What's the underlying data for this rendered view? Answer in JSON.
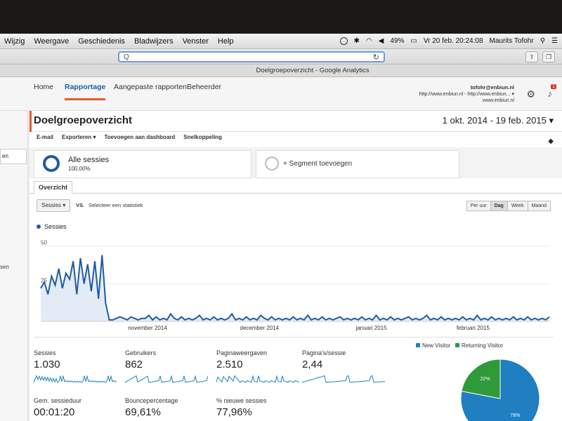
{
  "menubar": {
    "items": [
      "Wijzig",
      "Weergave",
      "Geschiedenis",
      "Bladwijzers",
      "Venster",
      "Help"
    ],
    "battery": "49%",
    "datetime": "Vr 20 feb.  20:24:08",
    "user": "Maurits Tofohr"
  },
  "browser": {
    "url_placeholder": "Q",
    "tab_title": "Doelgroepoverzicht - Google Analytics"
  },
  "ga_nav": {
    "items": [
      "Home",
      "Rapportage",
      "Aangepaste rapporten",
      "Beheerder"
    ],
    "active": "Rapportage",
    "account_email": "tofohr@enbiun.nl",
    "account_url": "http://www.enbiun.nl - http://www.enbiun...",
    "account_site": "www.enbiun.nl",
    "notification_count": "1"
  },
  "left": {
    "text1": "en",
    "text2": "sen"
  },
  "page": {
    "title": "Doelgroepoverzicht",
    "date_range": "1 okt. 2014 - 19 feb. 2015",
    "actions": [
      "E-mail",
      "Exporteren ▾",
      "Toevoegen aan dashboard",
      "Snelkoppeling"
    ]
  },
  "segments": {
    "all_label": "Alle sessies",
    "all_pct": "100,00%",
    "add_label": "+ Segment toevoegen"
  },
  "tab": "Overzicht",
  "controls": {
    "metric_dropdown": "Sessies",
    "vs": "VS.",
    "select_stat": "Selecteer een statistiek",
    "granularity": [
      "Per uur",
      "Dag",
      "Week",
      "Maand"
    ],
    "granularity_selected": "Dag"
  },
  "chart_data": {
    "type": "area",
    "series": [
      {
        "name": "Sessies",
        "color": "#1f5ba6"
      }
    ],
    "y_ticks": [
      "50",
      "25"
    ],
    "x_ticks": [
      "november 2014",
      "december 2014",
      "januari 2015",
      "februari 2015"
    ],
    "ylim": [
      0,
      55
    ],
    "x_start": "2014-10-01",
    "x_end": "2015-02-19",
    "values": [
      22,
      26,
      18,
      30,
      24,
      35,
      22,
      32,
      28,
      40,
      18,
      42,
      25,
      38,
      20,
      40,
      15,
      44,
      12,
      1,
      1,
      2,
      3,
      2,
      1,
      3,
      2,
      1,
      2,
      2,
      4,
      1,
      3,
      1,
      2,
      1,
      5,
      2,
      1,
      3,
      1,
      2,
      1,
      2,
      4,
      1,
      2,
      1,
      3,
      1,
      2,
      1,
      2,
      5,
      1,
      2,
      1,
      3,
      1,
      2,
      1,
      4,
      2,
      1,
      3,
      1,
      2,
      1,
      2,
      1,
      3,
      1,
      2,
      1,
      4,
      1,
      2,
      1,
      3,
      1,
      2,
      1,
      2,
      3,
      1,
      2,
      1,
      2,
      1,
      3,
      1,
      2,
      1,
      4,
      1,
      2,
      1,
      3,
      1,
      2,
      1,
      2,
      3,
      1,
      2,
      1,
      2,
      4,
      1,
      2,
      1,
      3,
      1,
      2,
      1,
      2,
      1,
      3,
      1,
      2,
      1,
      4,
      1,
      2,
      1,
      3,
      1,
      2,
      1,
      2,
      1,
      3,
      1,
      2,
      1,
      3,
      1,
      2,
      1,
      2,
      1,
      3
    ]
  },
  "metrics": [
    {
      "label": "Sessies",
      "value": "1.030"
    },
    {
      "label": "Gebruikers",
      "value": "862"
    },
    {
      "label": "Paginaweergaven",
      "value": "2.510"
    },
    {
      "label": "Pagina's/sessie",
      "value": "2,44"
    },
    {
      "label": "Gem. sessieduur",
      "value": "00:01:20"
    },
    {
      "label": "Bouncepercentage",
      "value": "69,61%"
    },
    {
      "label": "% nieuwe sessies",
      "value": "77,96%"
    }
  ],
  "pie": {
    "type": "pie",
    "labels": [
      "New Visitor",
      "Returning Visitor"
    ],
    "values": [
      78,
      22
    ],
    "value_labels": [
      "78%",
      "22%"
    ],
    "colors": [
      "#1f7fc0",
      "#2e9a3a"
    ]
  }
}
